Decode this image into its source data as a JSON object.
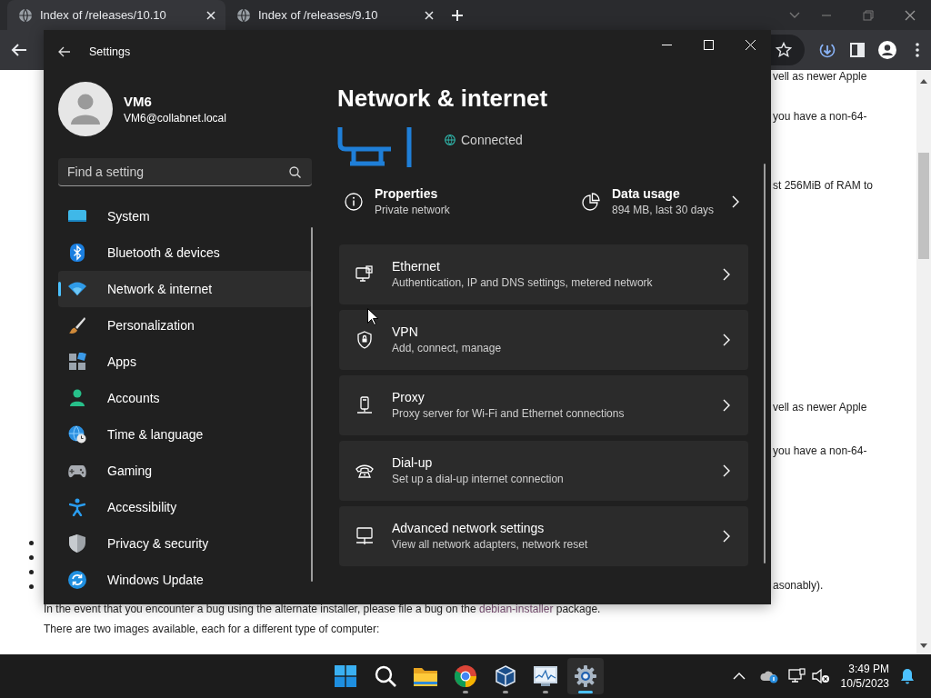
{
  "browser": {
    "tabs": [
      {
        "title": "Index of /releases/10.10",
        "selected": true
      },
      {
        "title": "Index of /releases/9.10",
        "selected": false
      }
    ],
    "page": {
      "fragments": [
        "vell as newer Apple",
        "you have a non-64-",
        "st 256MiB of RAM to",
        "vell as newer Apple",
        "you have a non-64-",
        "asonably)."
      ],
      "bullets": [
        {
          "kind": "bullet"
        },
        {
          "kind": "bullet"
        },
        {
          "kind": "bullet"
        },
        {
          "kind": "bullet"
        }
      ],
      "event_note": {
        "before": "In the event that you encounter a bug using the alternate installer, please file a bug on the ",
        "link": "debian-installer",
        "after": " package."
      },
      "images_note": "There are two images available, each for a different type of computer:"
    }
  },
  "settings": {
    "title": "Settings",
    "user": {
      "name": "VM6",
      "email": "VM6@collabnet.local"
    },
    "search": {
      "placeholder": "Find a setting"
    },
    "nav": [
      {
        "kind": "system",
        "label": "System",
        "selected": false
      },
      {
        "kind": "bluetooth",
        "label": "Bluetooth & devices",
        "selected": false
      },
      {
        "kind": "network",
        "label": "Network & internet",
        "selected": true
      },
      {
        "kind": "personalization",
        "label": "Personalization",
        "selected": false
      },
      {
        "kind": "apps",
        "label": "Apps",
        "selected": false
      },
      {
        "kind": "accounts",
        "label": "Accounts",
        "selected": false
      },
      {
        "kind": "time",
        "label": "Time & language",
        "selected": false
      },
      {
        "kind": "gaming",
        "label": "Gaming",
        "selected": false
      },
      {
        "kind": "accessibility",
        "label": "Accessibility",
        "selected": false
      },
      {
        "kind": "privacy",
        "label": "Privacy & security",
        "selected": false
      },
      {
        "kind": "update",
        "label": "Windows Update",
        "selected": false
      }
    ],
    "page_title": "Network & internet",
    "status": "Connected",
    "properties": {
      "title": "Properties",
      "subtitle": "Private network"
    },
    "data_usage": {
      "title": "Data usage",
      "subtitle": "894 MB, last 30 days"
    },
    "cards": [
      {
        "kind": "ethernet",
        "title": "Ethernet",
        "subtitle": "Authentication, IP and DNS settings, metered network"
      },
      {
        "kind": "vpn",
        "title": "VPN",
        "subtitle": "Add, connect, manage"
      },
      {
        "kind": "proxy",
        "title": "Proxy",
        "subtitle": "Proxy server for Wi-Fi and Ethernet connections"
      },
      {
        "kind": "dialup",
        "title": "Dial-up",
        "subtitle": "Set up a dial-up internet connection"
      },
      {
        "kind": "advanced",
        "title": "Advanced network settings",
        "subtitle": "View all network adapters, network reset"
      }
    ]
  },
  "taskbar": {
    "apps": [
      {
        "kind": "start",
        "running": false,
        "selected": false
      },
      {
        "kind": "search",
        "running": false,
        "selected": false
      },
      {
        "kind": "explorer",
        "running": false,
        "selected": false
      },
      {
        "kind": "chrome",
        "running": true,
        "selected": false
      },
      {
        "kind": "virtualbox",
        "running": true,
        "selected": false
      },
      {
        "kind": "monitor",
        "running": true,
        "selected": false
      },
      {
        "kind": "settings",
        "running": true,
        "selected": true
      }
    ],
    "clock": {
      "time": "3:49 PM",
      "date": "10/5/2023"
    }
  }
}
